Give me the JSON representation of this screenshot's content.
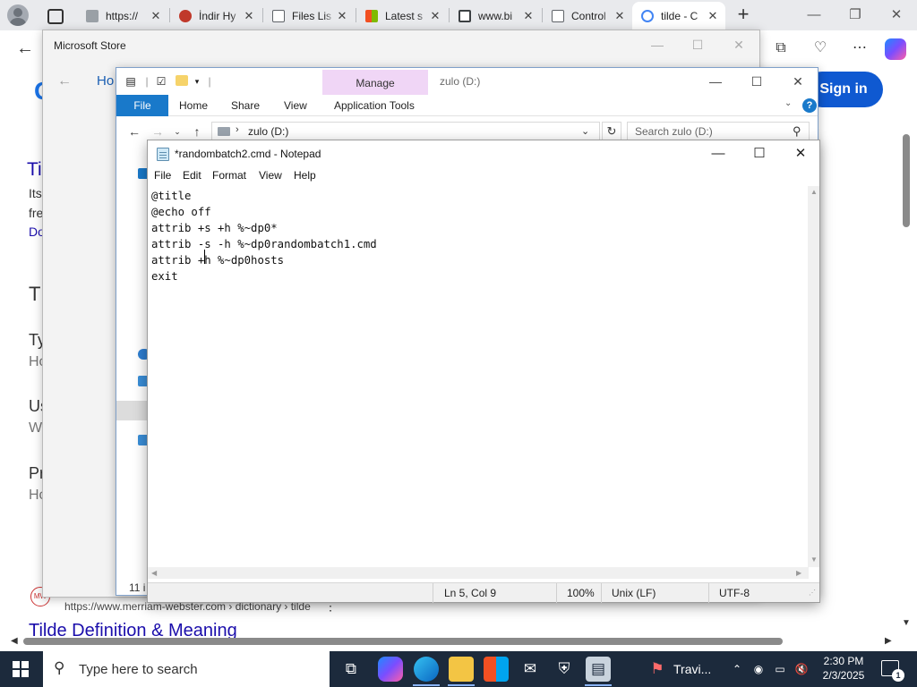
{
  "browser": {
    "tabs": [
      {
        "title": "https://",
        "favicon_color": "#9aa0a6"
      },
      {
        "title": "İndir Hy",
        "favicon_color": "#c0392b"
      },
      {
        "title": "Files Lis",
        "favicon_color": "#5f6368"
      },
      {
        "title": "Latest s",
        "favicon_color": "#f25022"
      },
      {
        "title": "www.bi",
        "favicon_color": "#3c4043"
      },
      {
        "title": "Control",
        "favicon_color": "#5f6368"
      },
      {
        "title": "tilde - C",
        "favicon_color": "#4285f4"
      }
    ],
    "new_tab_label": "+",
    "signin_label": "Sign in",
    "page": {
      "home_fragment": "Ho",
      "left_fragments": [
        "Ti",
        "Its",
        "fre",
        "Do",
        "Th",
        "Ty",
        "Ho",
        "Us",
        "Wl",
        "Pr",
        "Ho"
      ],
      "result_url": "https://www.merriam-webster.com › dictionary › tilde",
      "result_title": "Tilde Definition & Meaning",
      "mw_logo": "MW"
    }
  },
  "store_window": {
    "title": "Microsoft Store"
  },
  "explorer": {
    "manage_tab": "Manage",
    "title": "zulo (D:)",
    "ribbon": {
      "file": "File",
      "home": "Home",
      "share": "Share",
      "view": "View",
      "application_tools": "Application Tools"
    },
    "address": "zulo (D:)",
    "search_placeholder": "Search zulo (D:)",
    "status_fragment": "11 i"
  },
  "notepad": {
    "title": "*randombatch2.cmd - Notepad",
    "menu": [
      "File",
      "Edit",
      "Format",
      "View",
      "Help"
    ],
    "content": "@title\n@echo off\nattrib +s +h %~dp0*\nattrib -s -h %~dp0randombatch1.cmd\nattrib +h %~dp0hosts\nexit",
    "status": {
      "position": "Ln 5, Col 9",
      "zoom": "100%",
      "line_ending": "Unix (LF)",
      "encoding": "UTF-8"
    }
  },
  "taskbar": {
    "search_placeholder": "Type here to search",
    "news_label": "Travi...",
    "time": "2:30 PM",
    "date": "2/3/2025",
    "notification_count": "1"
  },
  "colors": {
    "accent": "#1979ca",
    "manage_highlight": "#f0d6f6",
    "taskbar": "#1c2a3c",
    "signin": "#0f59d1"
  }
}
